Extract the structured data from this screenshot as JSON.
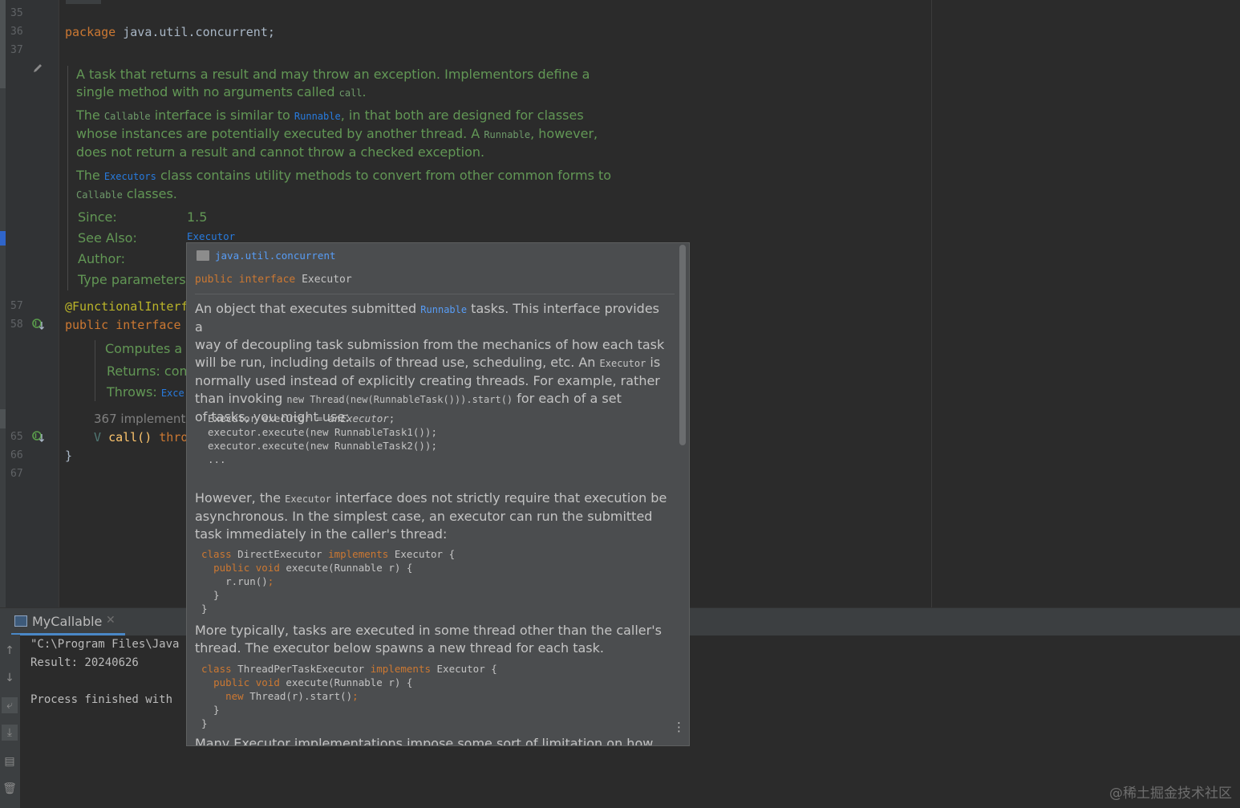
{
  "editor": {
    "line_numbers": [
      "35",
      "36",
      "37",
      "57",
      "58",
      "65",
      "66",
      "67"
    ],
    "package_kw": "package",
    "package_name": "java.util.concurrent;",
    "annotation_text": "@FunctionalInterf",
    "decl_kw1": "public",
    "decl_kw2": "interface",
    "closing_brace": "}",
    "method_type": "V",
    "method_name": "call()",
    "method_throws": "thro",
    "implementations_text": "367 implementa"
  },
  "javadoc": {
    "para1_a": "A task that returns a result and may throw an exception. Implementors define a",
    "para1_b": "single method with no arguments called ",
    "para1_code": "call",
    "para1_end": ".",
    "para2_a": "The ",
    "para2_code1": "Callable",
    "para2_b": " interface is similar to ",
    "para2_link": "Runnable",
    "para2_c": ", in that both are designed for classes",
    "para2_d": "whose instances are potentially executed by another thread. A ",
    "para2_code2": "Runnable",
    "para2_e": ", however,",
    "para2_f": "does not return a result and cannot throw a checked exception.",
    "para3_a": "The ",
    "para3_link": "Executors",
    "para3_b": " class contains utility methods to convert from other common forms to",
    "para3_code": "Callable",
    "para3_c": " classes.",
    "since_label": "Since:",
    "since_value": "1.5",
    "see_also_label": "See Also:",
    "see_also_value": "Executor",
    "author_label": "Author:",
    "type_params_label": "Type parameters:",
    "method_doc1": "Computes a r",
    "method_doc2": "Returns: com",
    "method_doc3": "Throws: ",
    "method_doc3_link": "Exce"
  },
  "run_panel": {
    "tab_label": "MyCallable",
    "console_lines": [
      "\"C:\\Program Files\\Java",
      "Result: 20240626",
      "",
      "Process finished with"
    ]
  },
  "popup": {
    "package_link": "java.util.concurrent",
    "decl_kw1": "public",
    "decl_kw2": "interface",
    "decl_name": "Executor",
    "p1_a": "An object that executes submitted ",
    "p1_link": "Runnable",
    "p1_b": " tasks. This interface provides a",
    "p1_c": "way of decoupling task submission from the mechanics of how each task",
    "p1_d": "will be run, including details of thread use, scheduling, etc. An ",
    "p1_code": "Executor",
    "p1_e": " is",
    "p1_f": "normally used instead of explicitly creating threads. For example, rather",
    "p1_g": "than invoking ",
    "p1_code2": "new Thread(new(RunnableTask())).start()",
    "p1_h": " for each of a set",
    "p1_i": "of tasks, you might use:",
    "code1": [
      "Executor executor = anExecutor;",
      "executor.execute(new RunnableTask1());",
      "executor.execute(new RunnableTask2());",
      "..."
    ],
    "p2_a": "However, the ",
    "p2_code": "Executor",
    "p2_b": " interface does not strictly require that execution be",
    "p2_c": "asynchronous. In the simplest case, an executor can run the submitted",
    "p2_d": "task immediately in the caller's thread:",
    "p3_a": "More typically, tasks are executed in some thread other than the caller's",
    "p3_b": "thread. The executor below spawns a new thread for each task.",
    "p4_cut": "Many Executor implementations impose some sort of limitation on how"
  },
  "watermark": "@稀土掘金技术社区"
}
